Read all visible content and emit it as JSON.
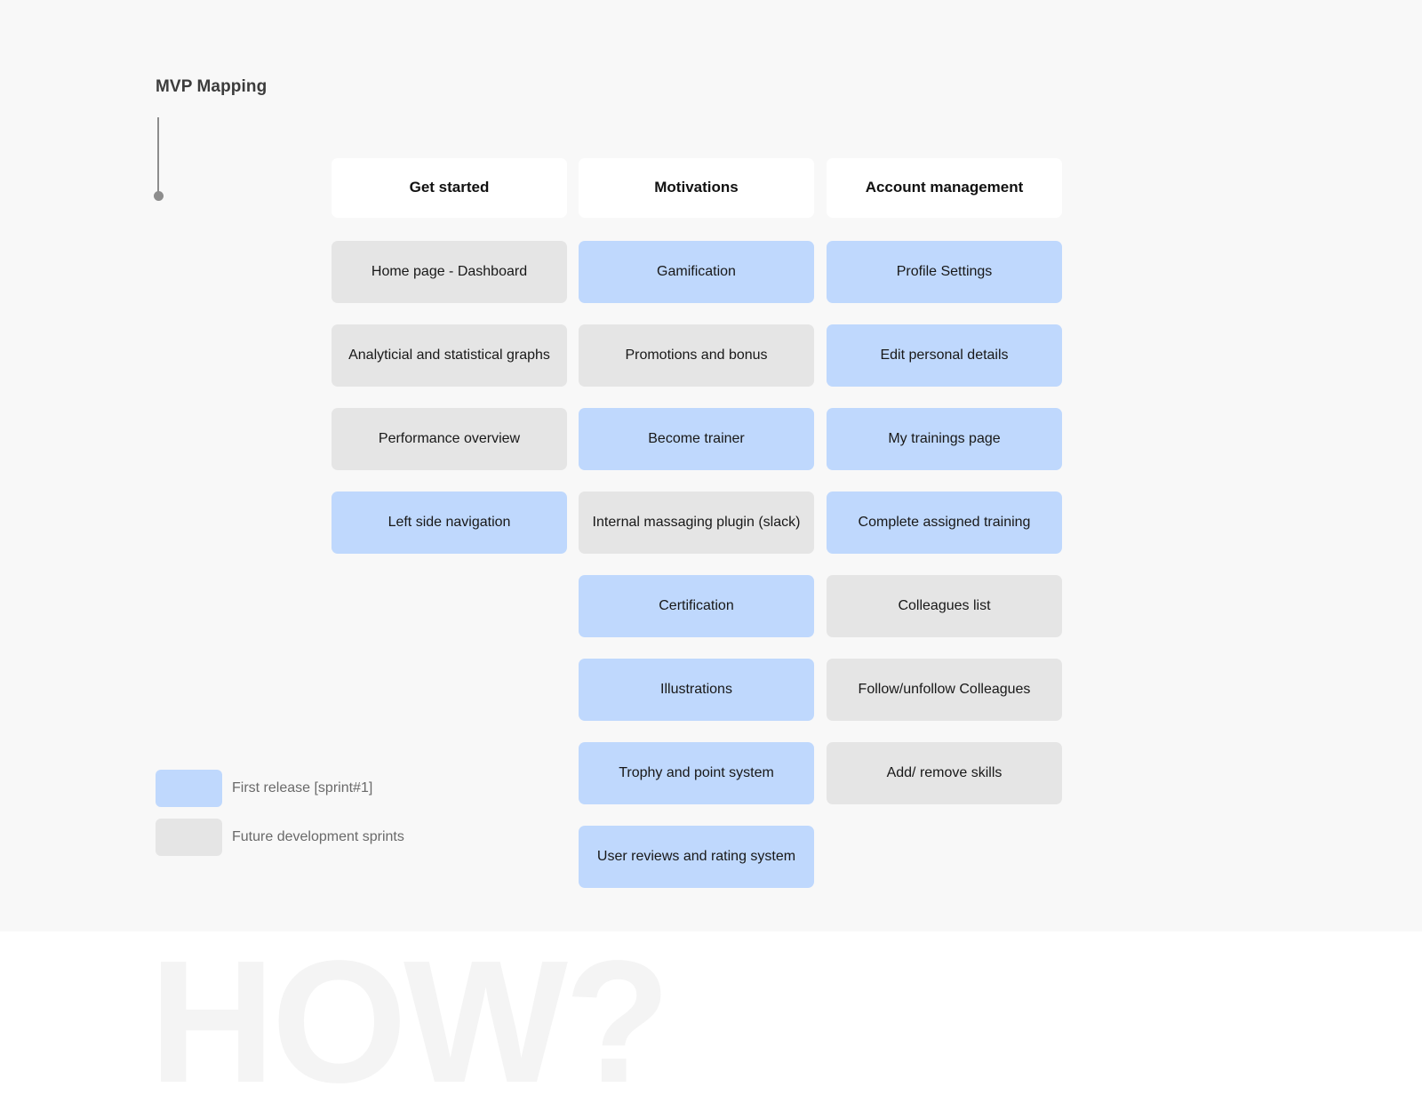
{
  "board": {
    "title": "MVP Mapping",
    "watermark": "HOW?"
  },
  "colors": {
    "first_release": "#bfd8fd",
    "future_sprints": "#e5e5e5",
    "panel_background": "#f8f8f8",
    "header_card": "#ffffff",
    "connector": "#8d8d8d",
    "title_text": "#3c3c3c",
    "legend_text": "#6a6a6a",
    "watermark_text": "#f4f4f4"
  },
  "legend": {
    "items": [
      {
        "label": "First release [sprint#1]",
        "swatch": "first"
      },
      {
        "label": "Future development sprints",
        "swatch": "future"
      }
    ]
  },
  "columns": [
    {
      "header": "Get started",
      "cards": [
        {
          "label": "Home page - Dashboard",
          "category": "future"
        },
        {
          "label": "Analyticial and statistical graphs",
          "category": "future"
        },
        {
          "label": "Performance overview",
          "category": "future"
        },
        {
          "label": "Left side navigation",
          "category": "first"
        }
      ]
    },
    {
      "header": "Motivations",
      "cards": [
        {
          "label": "Gamification",
          "category": "first"
        },
        {
          "label": "Promotions and bonus",
          "category": "future"
        },
        {
          "label": "Become trainer",
          "category": "first"
        },
        {
          "label": "Internal massaging plugin (slack)",
          "category": "future"
        },
        {
          "label": "Certification",
          "category": "first"
        },
        {
          "label": "Illustrations",
          "category": "first"
        },
        {
          "label": "Trophy and point system",
          "category": "first"
        },
        {
          "label": "User reviews and rating system",
          "category": "first"
        }
      ]
    },
    {
      "header": "Account management",
      "cards": [
        {
          "label": "Profile Settings",
          "category": "first"
        },
        {
          "label": "Edit personal details",
          "category": "first"
        },
        {
          "label": "My trainings page",
          "category": "first"
        },
        {
          "label": "Complete assigned training",
          "category": "first"
        },
        {
          "label": "Colleagues list",
          "category": "future"
        },
        {
          "label": "Follow/unfollow Colleagues",
          "category": "future"
        },
        {
          "label": "Add/ remove skills",
          "category": "future"
        }
      ]
    }
  ]
}
